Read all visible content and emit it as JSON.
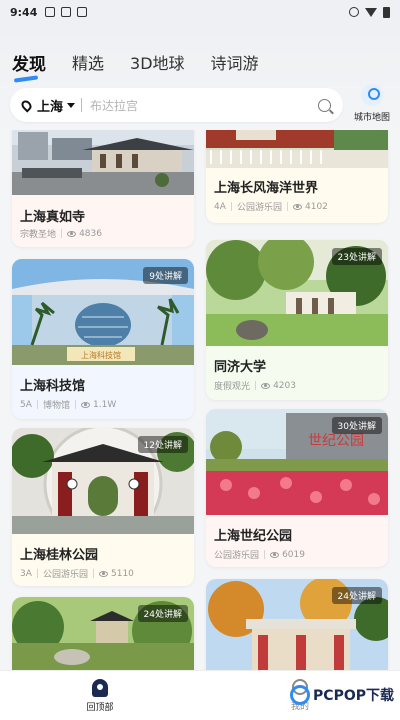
{
  "status": {
    "time": "9:44"
  },
  "tabs": [
    {
      "label": "发现"
    },
    {
      "label": "精选"
    },
    {
      "label": "3D地球"
    },
    {
      "label": "诗词游"
    }
  ],
  "search": {
    "city": "上海",
    "placeholder": "布达拉宫"
  },
  "city_map": {
    "label": "城市地图"
  },
  "cards": [
    {
      "name": "上海真如寺",
      "tag": "宗教圣地",
      "views": "4836",
      "badge": ""
    },
    {
      "name": "上海长风海洋世界",
      "tag": "公园游乐园",
      "level": "4A",
      "views": "4102",
      "badge": ""
    },
    {
      "name": "上海科技馆",
      "level": "5A",
      "tag": "博物馆",
      "views": "1.1W",
      "badge": "9处讲解",
      "sign_text": "上海科技馆"
    },
    {
      "name": "同济大学",
      "tag": "度假观光",
      "views": "4203",
      "badge": "23处讲解"
    },
    {
      "name": "上海桂林公园",
      "level": "3A",
      "tag": "公园游乐园",
      "views": "5110",
      "badge": "12处讲解"
    },
    {
      "name": "上海世纪公园",
      "tag": "公园游乐园",
      "views": "6019",
      "badge": "30处讲解",
      "sign_text": "世纪公园"
    },
    {
      "name": "",
      "badge": "24处讲解"
    },
    {
      "name": "",
      "badge": "24处讲解"
    }
  ],
  "bottom_nav": {
    "home": "回顶部",
    "mine": "我的"
  },
  "watermark": "PCPOP下载",
  "colors": {
    "accent": "#2f8cf0",
    "nav_dark": "#1a2a52"
  }
}
